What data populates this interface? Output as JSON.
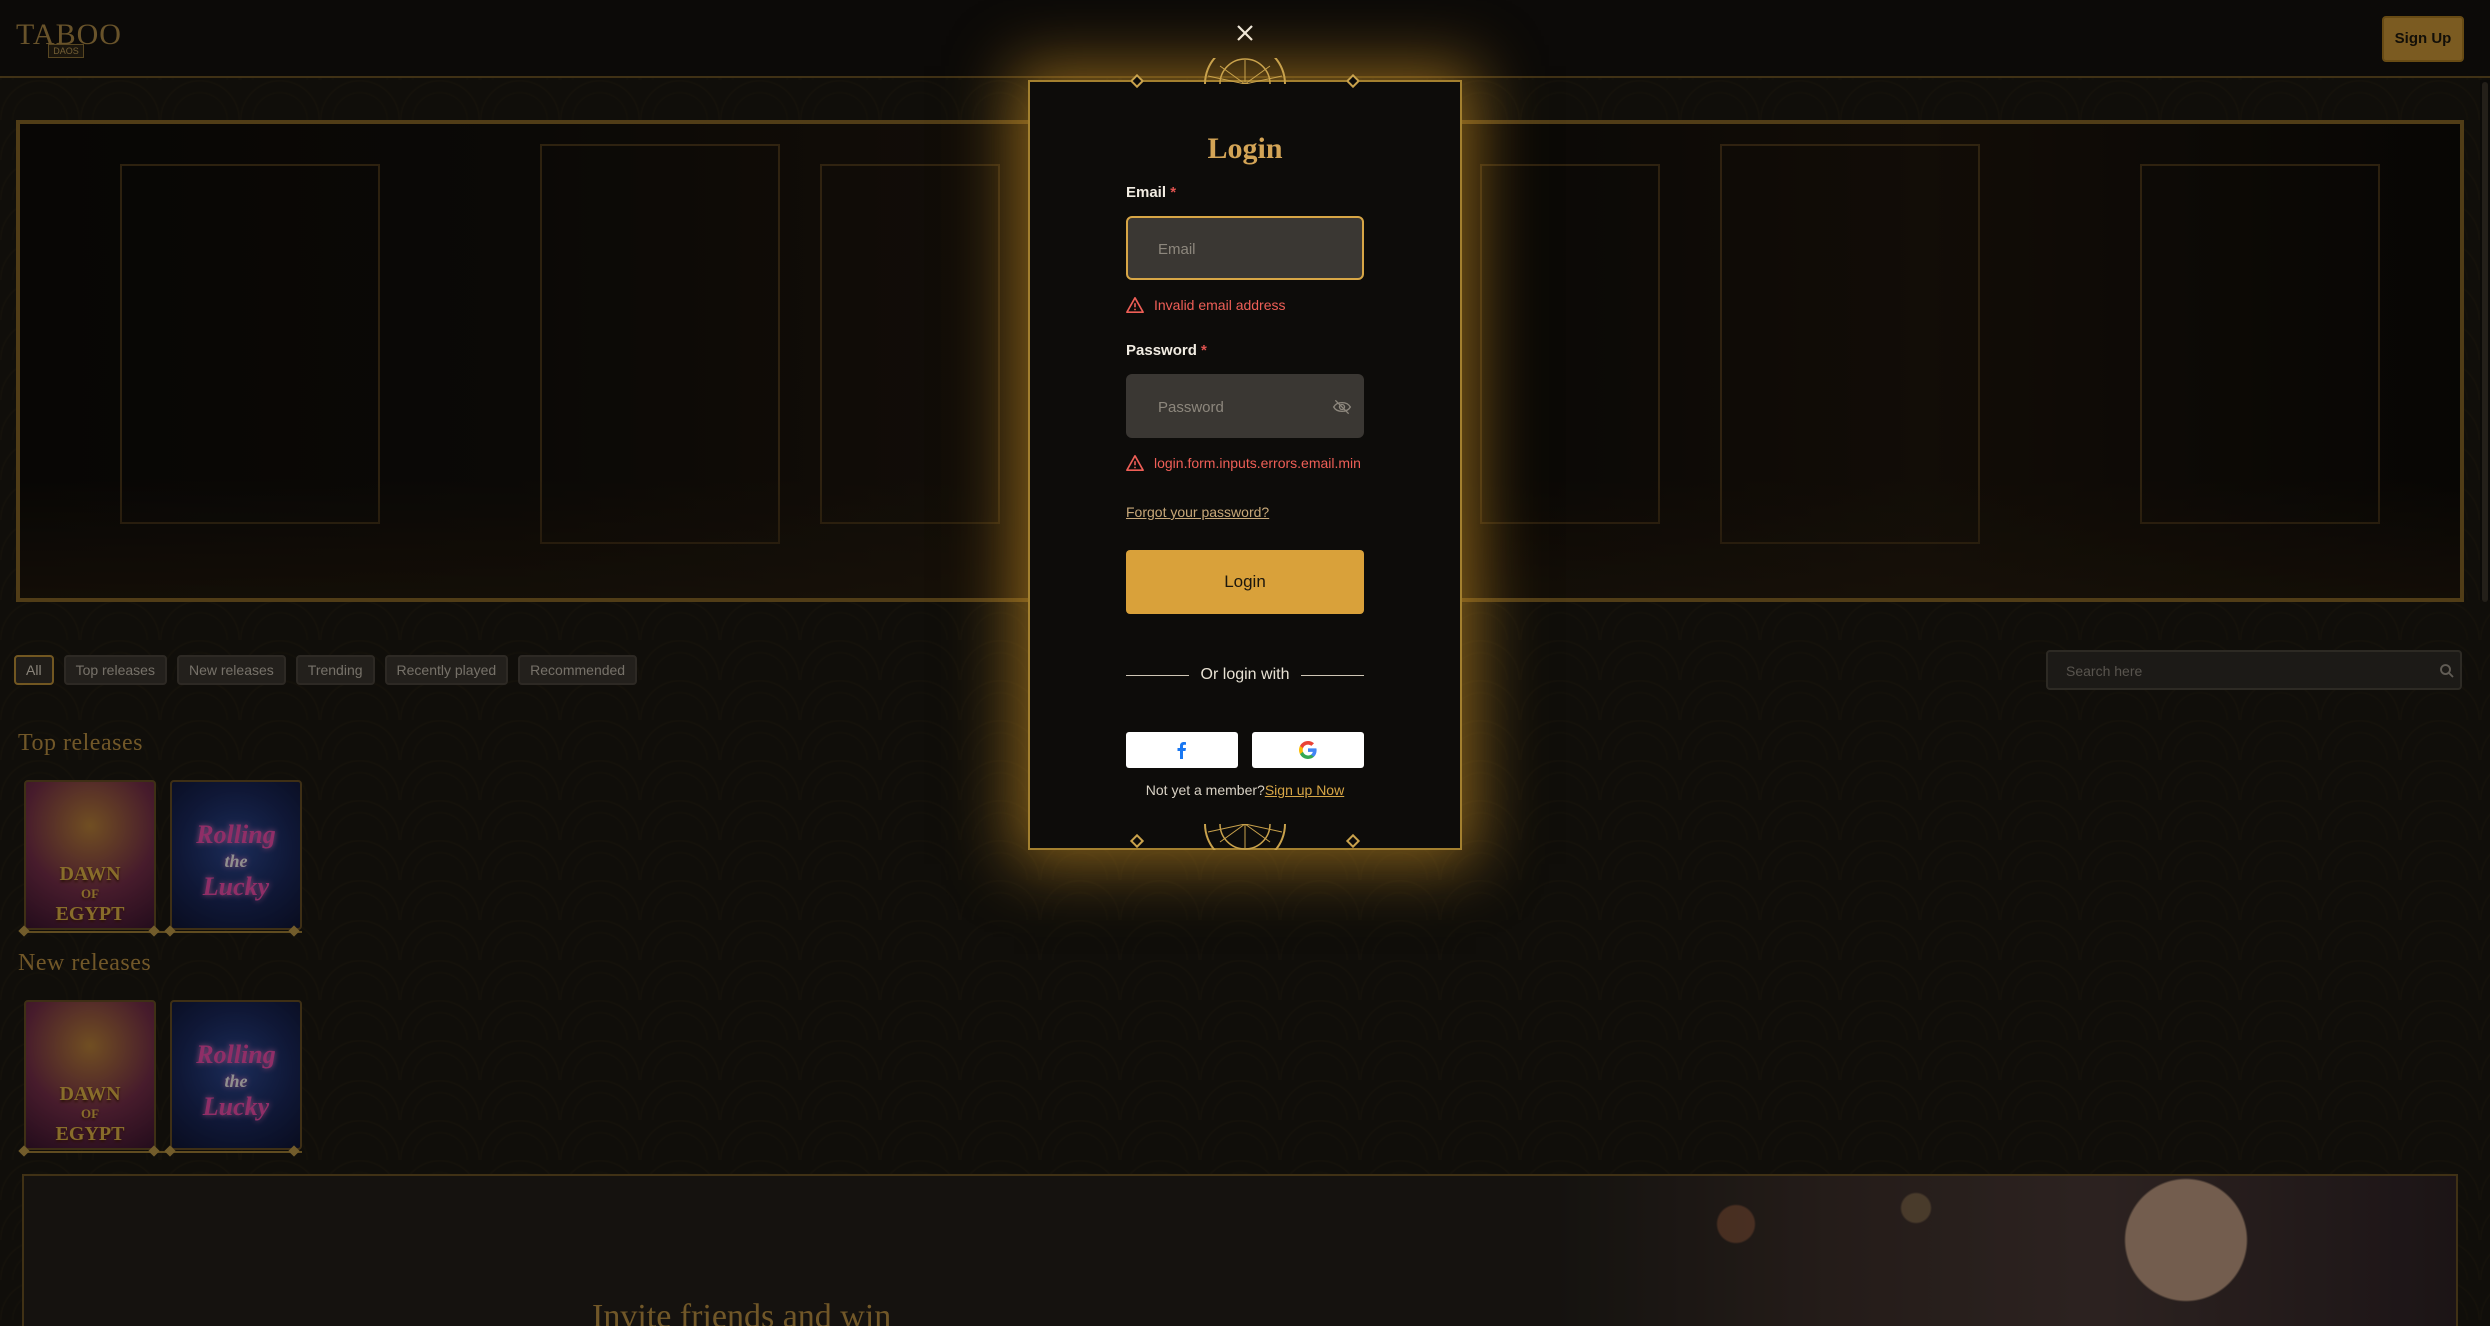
{
  "header": {
    "logo_text": "TABOO",
    "logo_sub": "DAOS",
    "signup_label": "Sign Up"
  },
  "filters": {
    "chips": [
      "All",
      "Top releases",
      "New releases",
      "Trending",
      "Recently played",
      "Recommended"
    ],
    "active": "All"
  },
  "search": {
    "placeholder": "Search here"
  },
  "sections": {
    "top_releases": "Top releases",
    "new_releases": "New releases"
  },
  "games": [
    {
      "name": "DAWN OF EGYPT",
      "line1": "DAWN",
      "line2": "OF",
      "line3": "EGYPT"
    },
    {
      "name": "Rolling the Lucky",
      "line1": "Rolling",
      "line2": "the",
      "line3": "Lucky"
    }
  ],
  "invite": {
    "title": "Invite friends and win"
  },
  "modal": {
    "title": "Login",
    "email": {
      "label": "Email",
      "required_mark": "*",
      "placeholder": "Email",
      "value": "",
      "error": "Invalid email address"
    },
    "password": {
      "label": "Password",
      "required_mark": "*",
      "placeholder": "Password",
      "value": "",
      "error": "login.form.inputs.errors.email.min"
    },
    "forgot_label": "Forgot your password?",
    "login_label": "Login",
    "or_label": "Or login with",
    "member_text": "Not yet a member?",
    "signup_link": "Sign up Now"
  },
  "colors": {
    "accent": "#d9a13a",
    "gold_text": "#c79a45",
    "error": "#ef5f57",
    "background": "#17150f"
  },
  "icons": [
    "close-icon",
    "search-icon",
    "eye-off-icon",
    "warning-icon",
    "facebook-icon",
    "google-icon"
  ]
}
